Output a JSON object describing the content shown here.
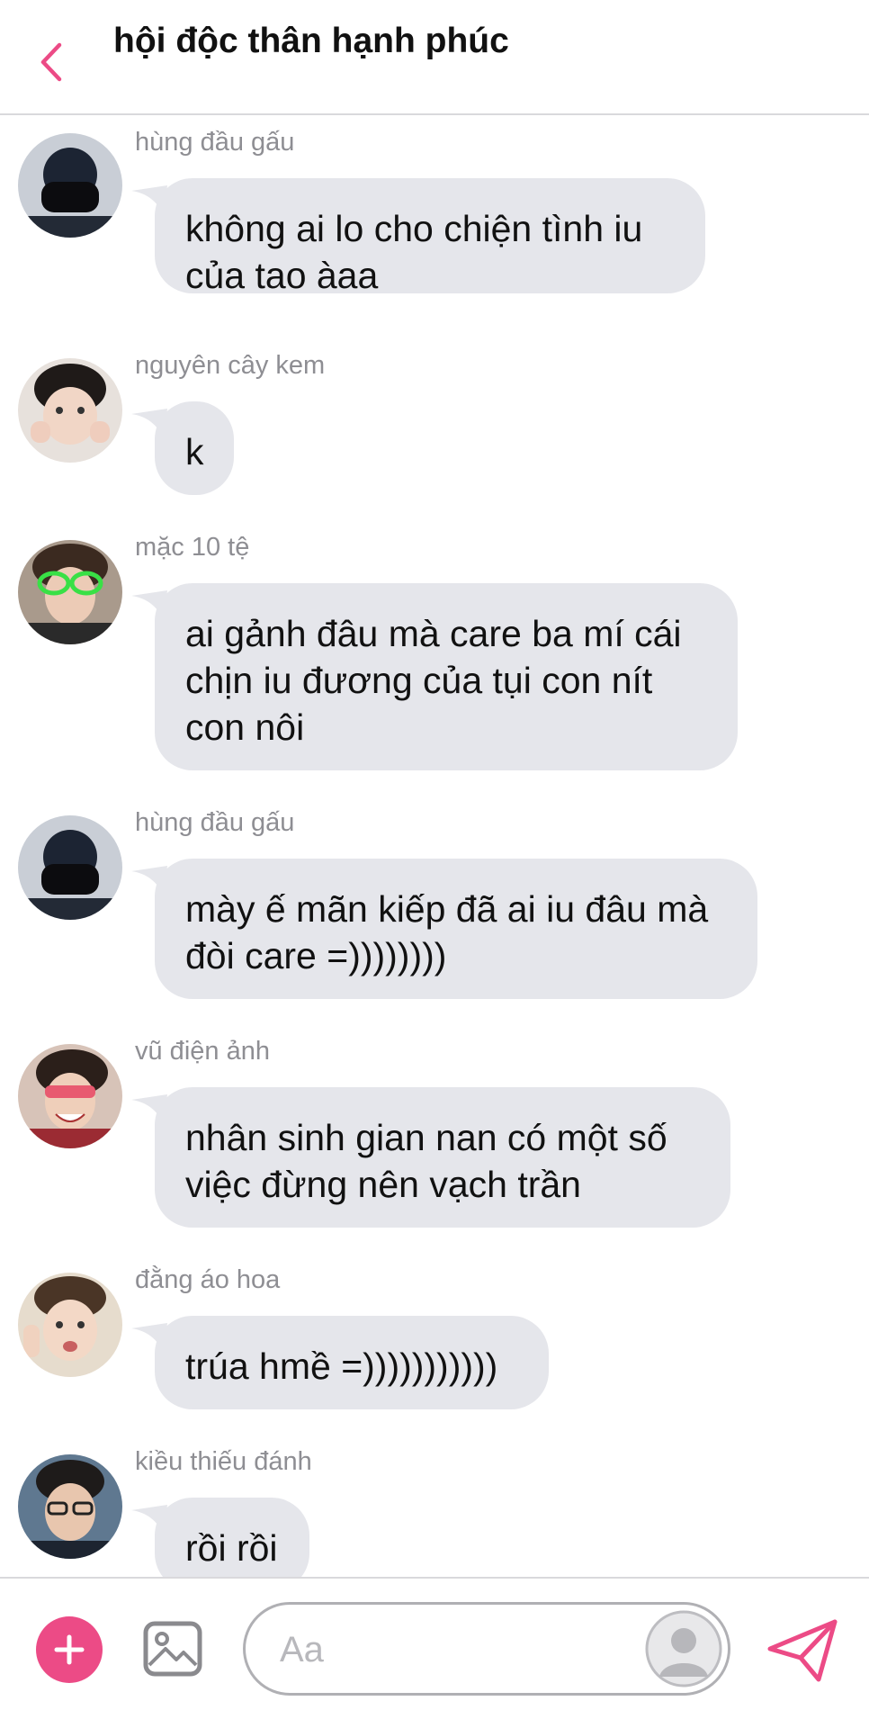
{
  "header": {
    "title": "hội độc thân hạnh phúc",
    "back_icon": "chevron-left-icon"
  },
  "messages": [
    {
      "sender": "hùng đầu gấu",
      "text": "không ai lo cho chiện tình iu\ncủa tao àaa"
    },
    {
      "sender": "nguyên cây kem",
      "text": "k"
    },
    {
      "sender": "mặc 10 tệ",
      "text": "ai gảnh đâu mà care ba mí cái\nchịn iu đương của tụi con nít\ncon nôi"
    },
    {
      "sender": "hùng đầu gấu",
      "text": "mày ế mãn kiếp đã ai iu đâu mà\nđòi care =))))))))"
    },
    {
      "sender": "vũ điện ảnh",
      "text": "nhân sinh gian nan có một số\nviệc đừng nên vạch trần"
    },
    {
      "sender": "đằng áo hoa",
      "text": "trúa hmề =)))))))))))"
    },
    {
      "sender": "kiều thiếu đánh",
      "text": "rồi rồi"
    }
  ],
  "composer": {
    "placeholder": "Aa",
    "plus_icon": "plus-icon",
    "image_icon": "image-icon",
    "send_icon": "send-icon"
  },
  "colors": {
    "accent": "#ec4b86",
    "bubble": "#e5e6eb",
    "sender_text": "#8e8e93"
  }
}
